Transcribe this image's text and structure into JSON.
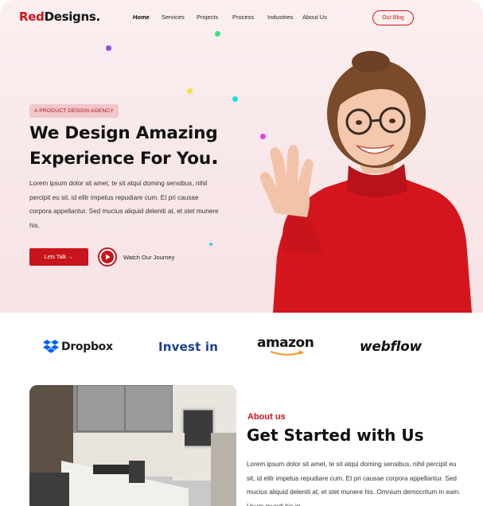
{
  "brand": {
    "logo_red": "Red",
    "logo_dark": "Designs."
  },
  "nav": {
    "items": [
      {
        "label": "Home",
        "active": true
      },
      {
        "label": "Services",
        "active": false
      },
      {
        "label": "Projects",
        "active": false
      },
      {
        "label": "Process",
        "active": false
      },
      {
        "label": "Industries",
        "active": false
      },
      {
        "label": "About Us",
        "active": false
      }
    ],
    "cta_label": "Our Blog"
  },
  "hero": {
    "badge": "A PRODUCT DESIGN AGENCY",
    "headline_line1": "We Design Amazing",
    "headline_line2": "Experience For You",
    "headline_period": ".",
    "description": "Lorem ipsum dolor sit amet, te sit atqui doming sensibus, nihil percipit eu sit, id elitr impetus repudiare cum. Et pri causae corpora appellantur. Sed mucius aliquid deleniti at, et stet munere his.",
    "primary_button": "Lets Talk →",
    "secondary_label": "Watch Our Journey"
  },
  "partners": [
    {
      "name": "Dropbox"
    },
    {
      "name": "Invest in"
    },
    {
      "name": "amazon"
    },
    {
      "name": "webflow"
    }
  ],
  "about": {
    "kicker": "About us",
    "title": "Get Started with Us",
    "text": "Lorem ipsum dolor sit amet, te sit atqui doming sensibus, nihil percipit eu sit, id elitr impetus repudiare cum. Et pri causae corpora appellantur. Sed mucius aliquid deleniti at, et stet munere his. Omnium democritum in eam. Usum mundi his in"
  },
  "colors": {
    "accent": "#c8141b",
    "hero_bg": "#f8e7e9",
    "dark": "#111111"
  },
  "icons": [
    "dropbox-logo-icon",
    "play-icon",
    "arrow-right-icon"
  ]
}
